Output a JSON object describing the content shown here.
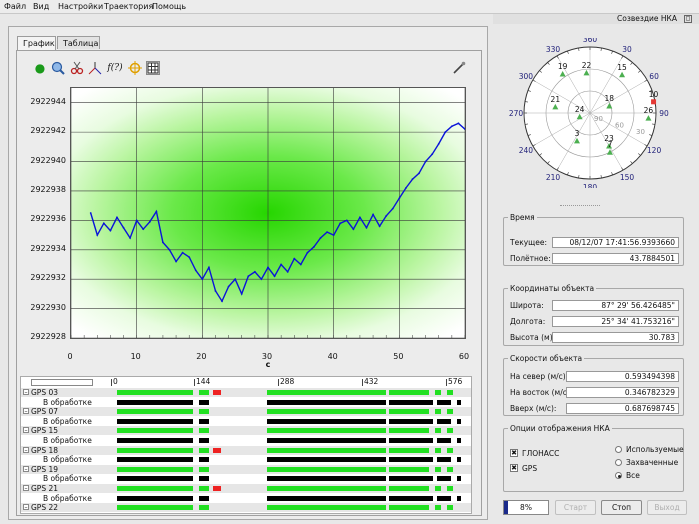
{
  "menu": {
    "items": [
      "Файл",
      "Вид",
      "Настройки",
      "Траектория",
      "Помощь"
    ]
  },
  "tabs": [
    "График",
    "Таблица"
  ],
  "toolbar": {
    "function_label": "f(?)"
  },
  "chart_data": {
    "type": "line",
    "xlabel": "c",
    "x_ticks": [
      "0",
      "10",
      "20",
      "30",
      "40",
      "50",
      "60"
    ],
    "y_ticks": [
      "2922944",
      "2922942",
      "2922940",
      "2922938",
      "2922936",
      "2922934",
      "2922932",
      "2922930",
      "2922928"
    ],
    "xlim": [
      0,
      60
    ],
    "ylim": [
      2922928,
      2922945
    ],
    "grid": true,
    "series": [
      {
        "color": "#0a14d8",
        "x": [
          3,
          4,
          5,
          6,
          7,
          8,
          9,
          10,
          11,
          12,
          13,
          14,
          15,
          16,
          17,
          18,
          19,
          20,
          21,
          22,
          23,
          24,
          25,
          26,
          27,
          28,
          29,
          30,
          31,
          32,
          33,
          34,
          35,
          36,
          37,
          38,
          39,
          40,
          41,
          42,
          43,
          44,
          45,
          46,
          47,
          48,
          49,
          50,
          51,
          52,
          53,
          54,
          55,
          56,
          57,
          58,
          59,
          60
        ],
        "y": [
          2922936.5,
          2922935.0,
          2922935.8,
          2922935.3,
          2922936.2,
          2922935.5,
          2922934.8,
          2922936.0,
          2922935.4,
          2922935.9,
          2922936.6,
          2922934.5,
          2922934.0,
          2922933.2,
          2922933.8,
          2922933.5,
          2922932.6,
          2922932.0,
          2922932.8,
          2922931.2,
          2922930.5,
          2922931.5,
          2922932.0,
          2922931.0,
          2922932.2,
          2922932.5,
          2922932.0,
          2922932.8,
          2922932.2,
          2922933.0,
          2922932.5,
          2922933.4,
          2922933.0,
          2922933.8,
          2922934.2,
          2922934.8,
          2922935.2,
          2922935.0,
          2922935.8,
          2922936.0,
          2922935.4,
          2922936.2,
          2922935.5,
          2922936.4,
          2922935.6,
          2922936.3,
          2922936.8,
          2922937.5,
          2922938.2,
          2922938.8,
          2922939.2,
          2922940.0,
          2922940.5,
          2922941.2,
          2922942.0,
          2922942.4,
          2922942.6,
          2922942.2
        ]
      }
    ]
  },
  "tree": {
    "ruler_labels": [
      "0",
      "144",
      "288",
      "432",
      "576"
    ],
    "rows": [
      {
        "label": "GPS 03",
        "sub": false
      },
      {
        "label": "В обработке",
        "sub": true
      },
      {
        "label": "GPS 07",
        "sub": false
      },
      {
        "label": "В обработке",
        "sub": true
      },
      {
        "label": "GPS 15",
        "sub": false
      },
      {
        "label": "В обработке",
        "sub": true
      },
      {
        "label": "GPS 18",
        "sub": false
      },
      {
        "label": "В обработке",
        "sub": true
      },
      {
        "label": "GPS 19",
        "sub": false
      },
      {
        "label": "В обработке",
        "sub": true
      },
      {
        "label": "GPS 21",
        "sub": false
      },
      {
        "label": "В обработке",
        "sub": true
      },
      {
        "label": "GPS 22",
        "sub": false
      }
    ]
  },
  "skyplot": {
    "title": "Созвездие НКА",
    "azimuth_labels": [
      "360",
      "30",
      "60",
      "90",
      "120",
      "150",
      "180",
      "210",
      "240",
      "270",
      "300",
      "330"
    ],
    "elevation_labels": [
      "30",
      "60",
      "90"
    ],
    "satellites": [
      {
        "id": "19",
        "az": 325,
        "el": 25,
        "color": "#4caf50"
      },
      {
        "id": "22",
        "az": 355,
        "el": 35,
        "color": "#4caf50"
      },
      {
        "id": "15",
        "az": 40,
        "el": 22,
        "color": "#4caf50"
      },
      {
        "id": "10",
        "az": 80,
        "el": 2,
        "color": "#e53935"
      },
      {
        "id": "21",
        "az": 280,
        "el": 42,
        "color": "#4caf50"
      },
      {
        "id": "24",
        "az": 250,
        "el": 75,
        "color": "#4caf50"
      },
      {
        "id": "18",
        "az": 70,
        "el": 62,
        "color": "#4caf50"
      },
      {
        "id": "26",
        "az": 95,
        "el": 10,
        "color": "#4caf50"
      },
      {
        "id": "3",
        "az": 205,
        "el": 48,
        "color": "#4caf50"
      },
      {
        "id": "23",
        "az": 150,
        "el": 38,
        "color": "#4caf50"
      },
      {
        "id": "7",
        "az": 153,
        "el": 30,
        "color": "#4caf50"
      }
    ]
  },
  "time": {
    "title": "Время",
    "current_label": "Текущее:",
    "current_value": "08/12/07 17:41:56.9393660",
    "flight_label": "Полётное:",
    "flight_value": "43.7884501"
  },
  "coords": {
    "title": "Координаты объекта",
    "lat_label": "Широта:",
    "lat_value": "87° 29' 56.426485\"",
    "lon_label": "Долгота:",
    "lon_value": "25° 34' 41.753216\"",
    "alt_label": "Высота (м):",
    "alt_value": "30.783"
  },
  "speeds": {
    "title": "Скорости объекта",
    "north_label": "На север (м/с):",
    "north_value": "0.593494398",
    "east_label": "На восток (м/с):",
    "east_value": "0.346782329",
    "up_label": "Вверх (м/с):",
    "up_value": "0.687698745"
  },
  "display": {
    "title": "Опции отображения НКА",
    "glonass_label": "ГЛОНАСС",
    "gps_label": "GPS",
    "used_label": "Используемые",
    "captured_label": "Захваченные",
    "all_label": "Все",
    "glonass_checked": true,
    "gps_checked": true,
    "selected_radio": "all"
  },
  "controls": {
    "progress": "8%",
    "progress_fraction": 0.08,
    "start_label": "Старт",
    "stop_label": "Стоп",
    "exit_label": "Выход"
  }
}
